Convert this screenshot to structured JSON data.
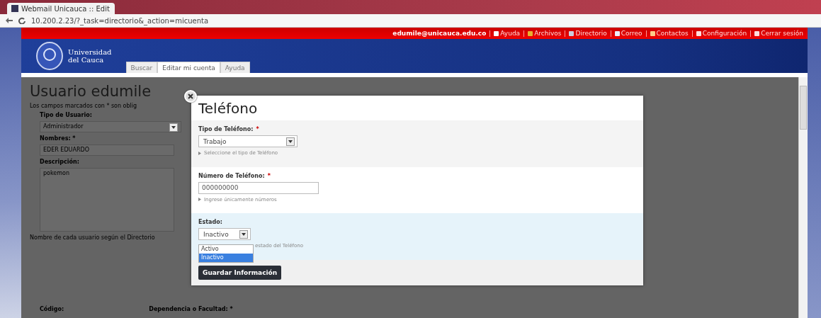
{
  "browser": {
    "tab_title": "Webmail Unicauca :: Edit",
    "url": "10.200.2.23/?_task=directorio&_action=micuenta"
  },
  "header": {
    "user": "edumile@unicauca.edu.co",
    "links": [
      {
        "label": "Ayuda"
      },
      {
        "label": "Archivos"
      },
      {
        "label": "Directorio"
      },
      {
        "label": "Correo"
      },
      {
        "label": "Contactos"
      },
      {
        "label": "Configuración"
      },
      {
        "label": "Cerrar sesión"
      }
    ],
    "logo_lines": [
      "Universidad",
      "del Cauca"
    ],
    "tabs": [
      {
        "label": "Buscar",
        "selected": false
      },
      {
        "label": "Editar mi cuenta",
        "selected": true
      },
      {
        "label": "Ayuda",
        "selected": false
      }
    ]
  },
  "form": {
    "title": "Usuario edumile",
    "note": "Los campos marcados con * son oblig",
    "fields": [
      {
        "label": "Tipo de Usuario:",
        "kind": "select",
        "value": "Administrador"
      },
      {
        "label": "Nombres: *",
        "kind": "input",
        "value": "EDER  EDUARDO"
      },
      {
        "label": "Descripción:",
        "kind": "textarea",
        "value": "pokemon"
      }
    ],
    "hint": "Nombre de cada usuario según el Directorio",
    "bottom_labels": [
      "Código:",
      "Dependencia o Facultad: *"
    ]
  },
  "dialog": {
    "title": "Teléfono",
    "sections": [
      {
        "kind": "select",
        "label": "Tipo de Teléfono:",
        "mark": "*",
        "value": "Trabajo",
        "hint": "Seleccione el tipo de Teléfono"
      },
      {
        "kind": "input",
        "label": "Número de Teléfono:",
        "mark": "*",
        "value": "000000000",
        "hint": "Ingrese únicamente números"
      },
      {
        "kind": "open-select",
        "label": "Estado:",
        "value": "Inactivo",
        "hint": "estado del Teléfono",
        "options": [
          {
            "label": "Activo",
            "selected": false
          },
          {
            "label": "Inactivo",
            "selected": true
          }
        ]
      }
    ],
    "button": "Guardar Información"
  }
}
